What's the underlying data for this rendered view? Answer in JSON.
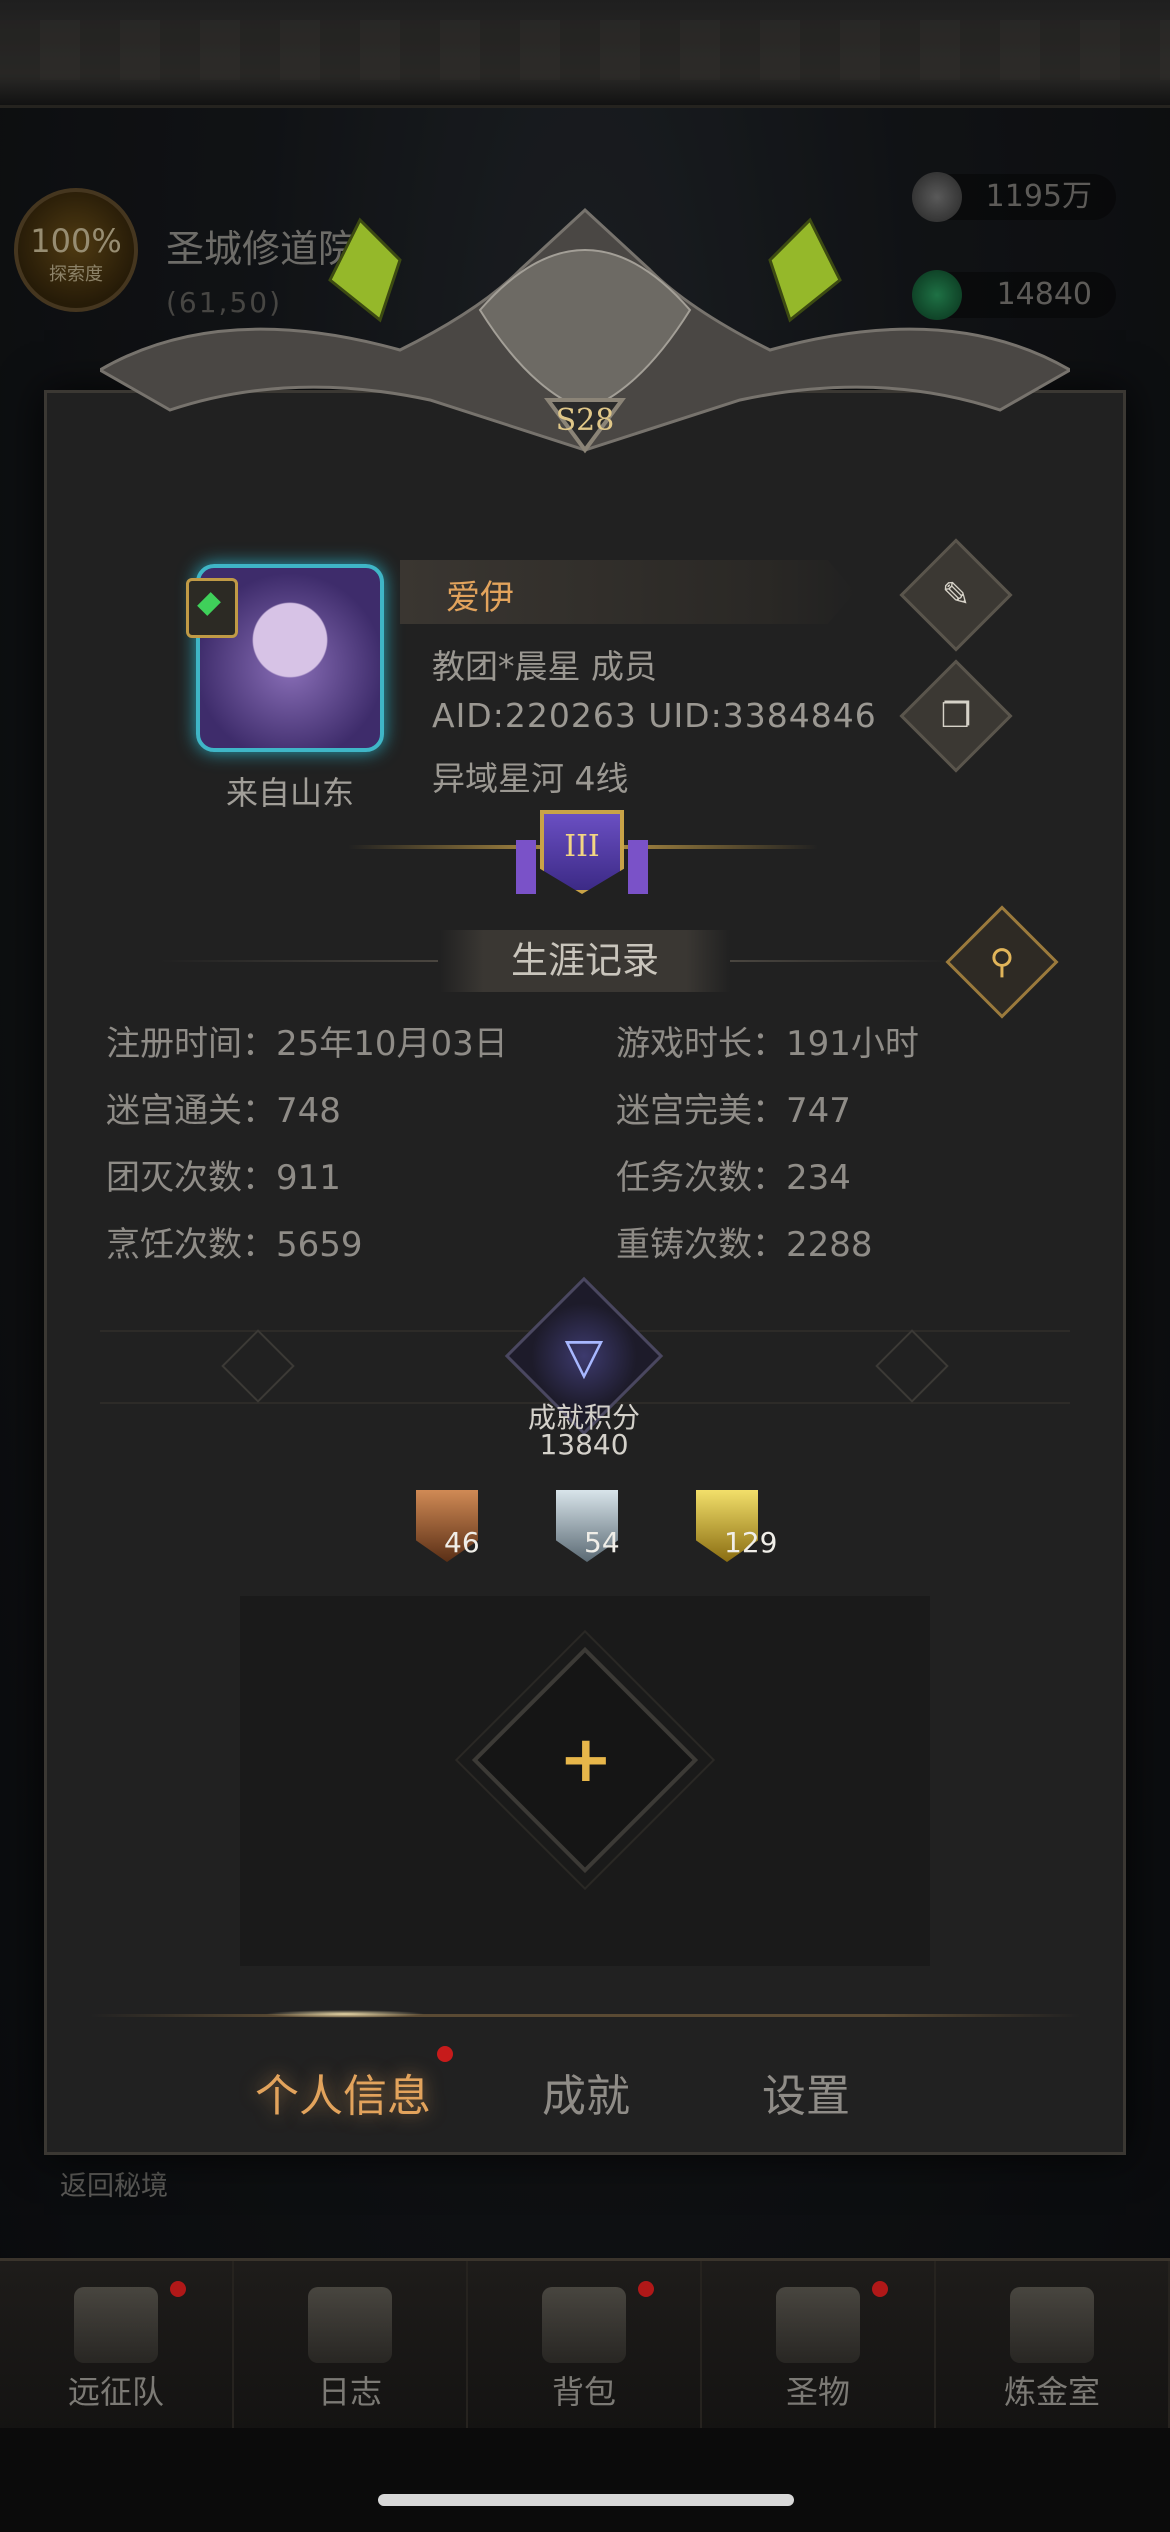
{
  "location": {
    "explore_pct": "100%",
    "explore_label": "探索度",
    "name": "圣城修道院",
    "coords": "(61,50)"
  },
  "resources": [
    {
      "icon": "stone-icon",
      "value": "1195万"
    },
    {
      "icon": "emerald-icon",
      "value": "14840"
    }
  ],
  "season_badge": "S28",
  "profile": {
    "name": "爱伊",
    "guild": "教团*晨星  成员",
    "ids": "AID:220263 UID:3384846",
    "server": "异域星河  4线",
    "from": "来自山东",
    "rank_numeral": "III"
  },
  "career": {
    "title": "生涯记录",
    "stats": [
      {
        "label": "注册时间：25年10月03日"
      },
      {
        "label": "游戏时长：191小时"
      },
      {
        "label": "迷宫通关：748"
      },
      {
        "label": "迷宫完美：747"
      },
      {
        "label": "团灭次数：911"
      },
      {
        "label": "任务次数：234"
      },
      {
        "label": "烹饪次数：5659"
      },
      {
        "label": "重铸次数：2288"
      }
    ]
  },
  "achievements": {
    "label": "成就积分",
    "score": "13840",
    "medals": [
      {
        "type": "bronze",
        "count": "46"
      },
      {
        "type": "silver",
        "count": "54"
      },
      {
        "type": "gold",
        "count": "129"
      }
    ]
  },
  "tabs": [
    "个人信息",
    "成就",
    "设置"
  ],
  "return_label": "返回秘境",
  "bottom_nav": [
    {
      "label": "远征队",
      "dot": true
    },
    {
      "label": "日志",
      "dot": false
    },
    {
      "label": "背包",
      "dot": true
    },
    {
      "label": "圣物",
      "dot": true
    },
    {
      "label": "炼金室",
      "dot": false
    }
  ]
}
